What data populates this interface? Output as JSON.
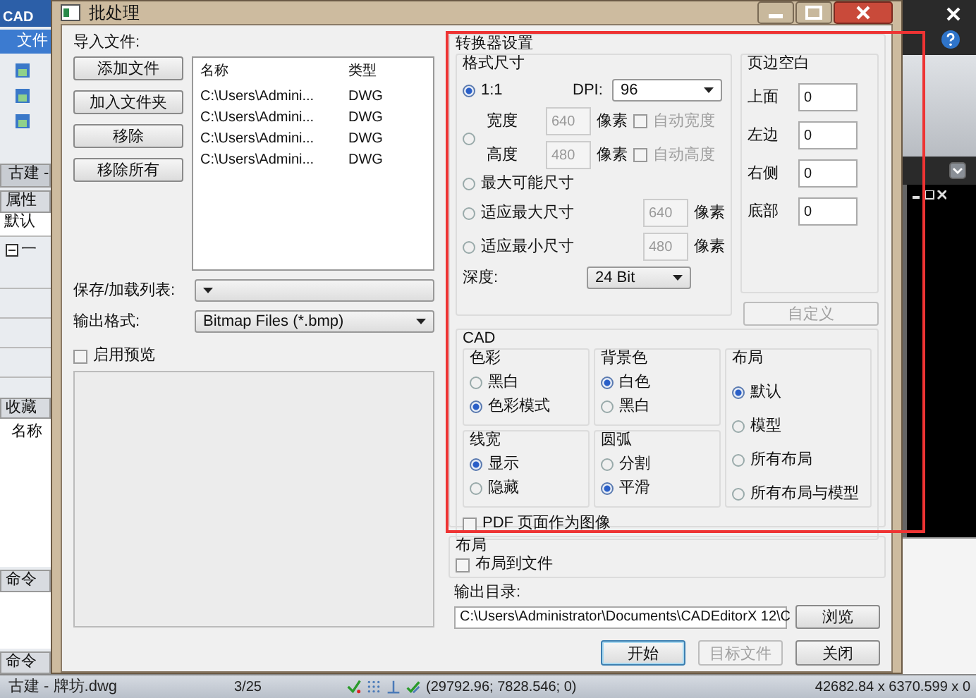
{
  "app_sidebar": {
    "logo": "CAD",
    "menu_tab": "文件",
    "doc_tab": "古建 -",
    "properties_tab": "属性",
    "properties_value": "默认",
    "tree_node": "一",
    "favorites_tab": "收藏",
    "favorites_column": "名称",
    "command_tabs": [
      "命令",
      "命令"
    ]
  },
  "dialog": {
    "title": "批处理",
    "import": {
      "label": "导入文件:",
      "buttons": [
        "添加文件",
        "加入文件夹",
        "移除",
        "移除所有"
      ],
      "file_list": {
        "columns": [
          "名称",
          "类型"
        ],
        "rows": [
          [
            "C:\\Users\\Admini...",
            "DWG"
          ],
          [
            "C:\\Users\\Admini...",
            "DWG"
          ],
          [
            "C:\\Users\\Admini...",
            "DWG"
          ],
          [
            "C:\\Users\\Admini...",
            "DWG"
          ]
        ]
      }
    },
    "save_load_list": {
      "label": "保存/加载列表:"
    },
    "output_format": {
      "label": "输出格式:",
      "value": "Bitmap Files (*.bmp)"
    },
    "enable_preview": {
      "label": "启用预览",
      "checked": false
    },
    "converter": {
      "title": "转换器设置",
      "format_size": {
        "title": "格式尺寸",
        "scale": {
          "label": "1:1",
          "selected": true
        },
        "dpi": {
          "label": "DPI:",
          "value": "96"
        },
        "custom_size": {
          "selected": false,
          "rows": [
            {
              "label": "宽度",
              "value": "640",
              "unit": "像素",
              "auto_label": "自动宽度",
              "auto_checked": false,
              "disabled": true
            },
            {
              "label": "高度",
              "value": "480",
              "unit": "像素",
              "auto_label": "自动高度",
              "auto_checked": false,
              "disabled": true
            }
          ]
        },
        "max_possible": {
          "label": "最大可能尺寸",
          "selected": false
        },
        "fit_options": [
          {
            "label": "适应最大尺寸",
            "selected": false,
            "value": "640",
            "unit": "像素",
            "disabled": true
          },
          {
            "label": "适应最小尺寸",
            "selected": false,
            "value": "480",
            "unit": "像素",
            "disabled": true
          }
        ],
        "depth": {
          "label": "深度:",
          "value": "24 Bit"
        }
      },
      "margins": {
        "title": "页边空白",
        "fields": [
          {
            "label": "上面",
            "value": "0"
          },
          {
            "label": "左边",
            "value": "0"
          },
          {
            "label": "右侧",
            "value": "0"
          },
          {
            "label": "底部",
            "value": "0"
          }
        ]
      },
      "custom_button": {
        "label": "自定义",
        "disabled": true
      },
      "cad": {
        "title": "CAD",
        "groups": [
          {
            "title": "色彩",
            "options": [
              {
                "label": "黑白",
                "selected": false
              },
              {
                "label": "色彩模式",
                "selected": true
              }
            ]
          },
          {
            "title": "线宽",
            "options": [
              {
                "label": "显示",
                "selected": true
              },
              {
                "label": "隐藏",
                "selected": false
              }
            ]
          },
          {
            "title": "背景色",
            "options": [
              {
                "label": "白色",
                "selected": true
              },
              {
                "label": "黑白",
                "selected": false
              }
            ]
          },
          {
            "title": "圆弧",
            "options": [
              {
                "label": "分割",
                "selected": false
              },
              {
                "label": "平滑",
                "selected": true
              }
            ]
          },
          {
            "title": "布局",
            "options": [
              {
                "label": "默认",
                "selected": true
              },
              {
                "label": "模型",
                "selected": false
              },
              {
                "label": "所有布局",
                "selected": false
              },
              {
                "label": "所有布局与模型",
                "selected": false
              }
            ]
          }
        ],
        "pdf_as_image": {
          "label": "PDF 页面作为图像",
          "checked": false
        }
      }
    },
    "layout": {
      "title": "布局",
      "to_file": {
        "label": "布局到文件",
        "checked": false
      }
    },
    "output_dir": {
      "label": "输出目录:",
      "value": "C:\\Users\\Administrator\\Documents\\CADEditorX 12\\C",
      "browse_button": "浏览"
    },
    "buttons": [
      {
        "label": "开始",
        "disabled": false,
        "default": true
      },
      {
        "label": "目标文件",
        "disabled": true,
        "default": false
      },
      {
        "label": "关闭",
        "disabled": false,
        "default": false
      }
    ]
  },
  "status_bar": {
    "file": "古建 - 牌坊.dwg",
    "page": "3/25",
    "coordinates": "(29792.96; 7828.546; 0)",
    "dimensions": "42682.84 x 6370.599 x 0"
  }
}
